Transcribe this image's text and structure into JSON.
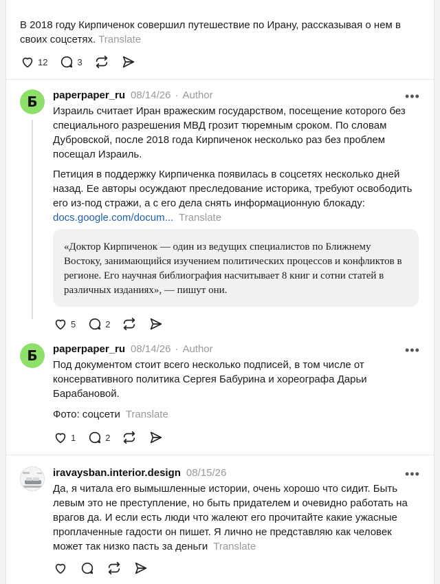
{
  "post0": {
    "text": "В 2018 году Кирпиченок совершил путешествие по Ирану, рассказывая о нем в своих соцсетях.",
    "translate": "Translate",
    "likes": "12",
    "replies": "3"
  },
  "reply1": {
    "username": "paperpaper_ru",
    "date": "08/14/26",
    "role": "Author",
    "avatar_letter": "Б",
    "p1": "Израиль считает Иран вражеским государством, посещение которого без специального разрешения МВД грозит тюремным сроком. По словам Дубровской, после 2018 года Кирпиченок несколько раз без проблем посещал Израиль.",
    "p2": "Петиция в поддержку Кирпиченка появилась в соцсетях несколько дней назад. Ее авторы осуждают преследование историка, требуют освободить его из-под стражи, а с его дела снять информационную блокаду:",
    "link": "docs.google.com/docum...",
    "translate": "Translate",
    "quote": "«Доктор Кирпиченок — один из ведущих специалистов по Ближнему Востоку, занимающийся изучением политических процессов и конфликтов в регионе. Его научная библиография насчитывает 8 книг и сотни статей в различных изданиях», — пишут они.",
    "likes": "5",
    "replies": "2"
  },
  "reply2": {
    "username": "paperpaper_ru",
    "date": "08/14/26",
    "role": "Author",
    "avatar_letter": "Б",
    "p1": "Под документом стоит всего несколько подписей, в том числе от консервативного политика Сергея Бабурина и хореографа Дарьи Барабановой.",
    "p2": "Фото: соцсети",
    "translate": "Translate",
    "likes": "1",
    "replies": "2"
  },
  "reply3": {
    "username": "iravaysban.interior.design",
    "date": "08/15/26",
    "text": "Да, я читала его вымышленные истории, очень хорошо что сидит. Быть левым это не преступление, но быть придателем и очевидно работать на врагов да. И если есть люди что жалеют его прочитайте какие ужасные проплаченные гадости он пишет. Я лично не представляю как человек может так низко пасть за деньги",
    "translate": "Translate"
  },
  "more_glyph": "•••",
  "colors": {
    "avatar_green": "#8ee06a",
    "link": "#1e5fa8",
    "muted": "#9a9a9a"
  }
}
